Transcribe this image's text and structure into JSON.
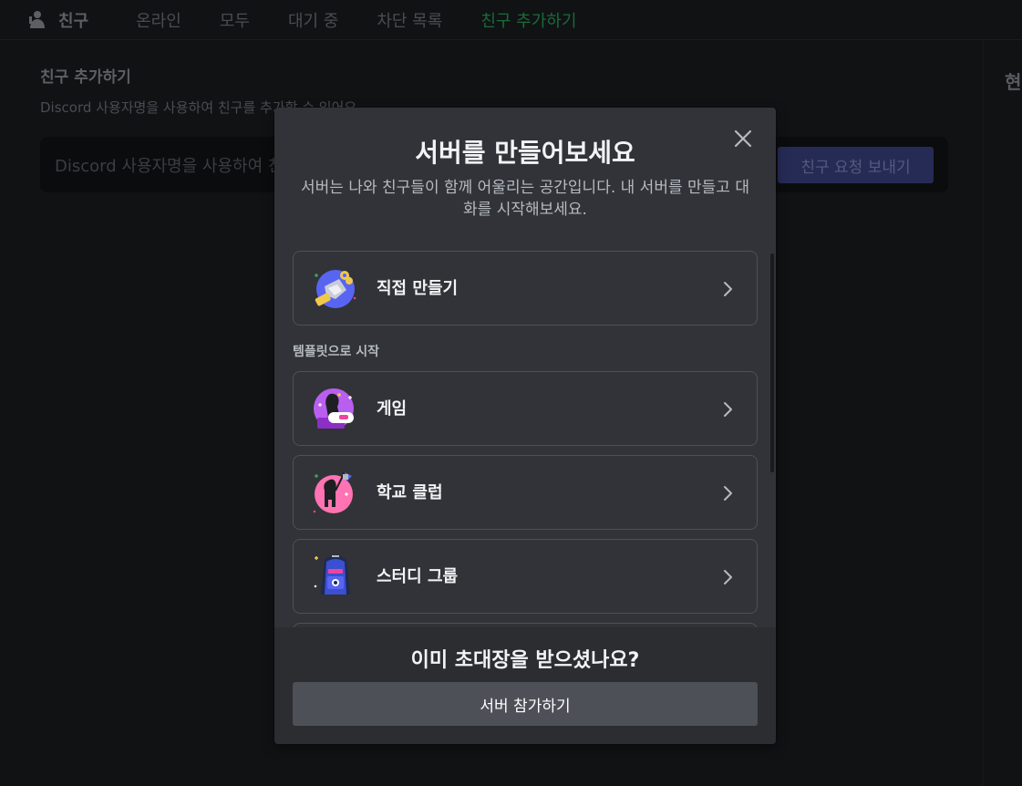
{
  "background": {
    "header": {
      "friends_label": "친구",
      "tabs": [
        "온라인",
        "모두",
        "대기 중",
        "차단 목록",
        "친구 추가하기"
      ]
    },
    "add_friend": {
      "title": "친구 추가하기",
      "description": "Discord 사용자명을 사용하여 친구를 추가할 수 있어요.",
      "input_placeholder": "Discord 사용자명을 사용하여 친구를 추가할 수 있어요.",
      "send_button": "친구 요청 보내기"
    },
    "right_panel_heading": "현"
  },
  "modal": {
    "title": "서버를 만들어보세요",
    "subtitle": "서버는 나와 친구들이 함께 어울리는 공간입니다. 내 서버를 만들고 대화를 시작해보세요.",
    "create_option": {
      "label": "직접 만들기",
      "icon": "create-server-icon"
    },
    "template_section_label": "템플릿으로 시작",
    "templates": [
      {
        "label": "게임",
        "icon": "gaming-icon"
      },
      {
        "label": "학교 클럽",
        "icon": "school-club-icon"
      },
      {
        "label": "스터디 그룹",
        "icon": "study-group-icon"
      }
    ],
    "footer": {
      "title": "이미 초대장을 받으셨나요?",
      "join_button": "서버 참가하기"
    }
  }
}
